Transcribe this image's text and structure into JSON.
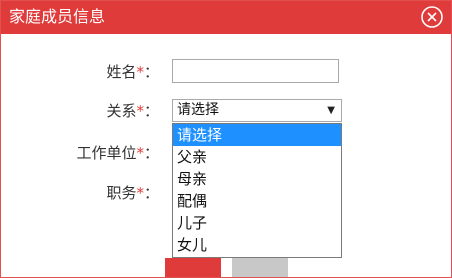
{
  "dialog": {
    "title": "家庭成员信息"
  },
  "form": {
    "name_label": "姓名",
    "relation_label": "关系",
    "workplace_label": "工作单位",
    "position_label": "职务",
    "required_mark": "*",
    "colon": "：",
    "name_value": "",
    "relation_selected": "请选择"
  },
  "relation_options": [
    "请选择",
    "父亲",
    "母亲",
    "配偶",
    "儿子",
    "女儿"
  ],
  "colors": {
    "accent": "#e03b3b",
    "highlight": "#1e90ff"
  }
}
